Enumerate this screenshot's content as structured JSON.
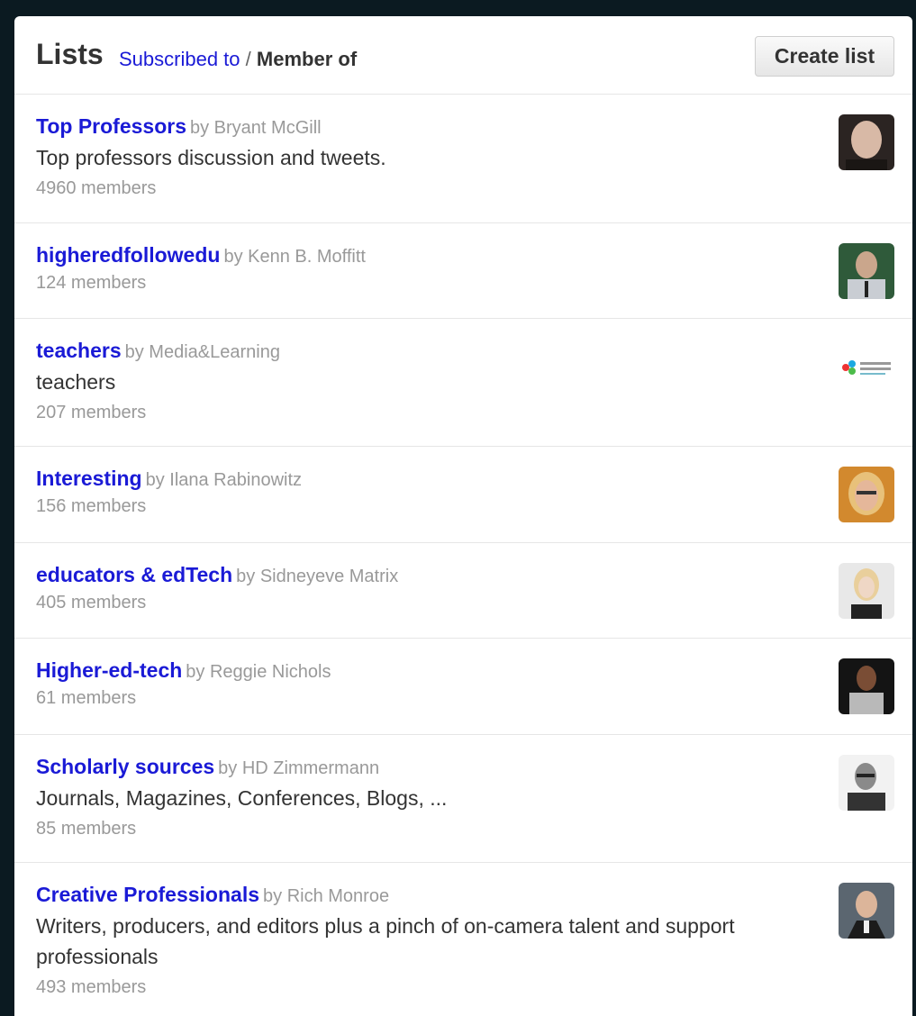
{
  "header": {
    "title": "Lists",
    "tab_subscribed": "Subscribed to",
    "separator": "/",
    "tab_member": "Member of",
    "create_label": "Create list"
  },
  "lists": [
    {
      "name": "Top Professors",
      "by": "by Bryant McGill",
      "description": "Top professors discussion and tweets.",
      "members": "4960 members"
    },
    {
      "name": "higheredfollowedu",
      "by": "by Kenn B. Moffitt",
      "description": "",
      "members": "124 members"
    },
    {
      "name": "teachers",
      "by": "by Media&Learning",
      "description": "teachers",
      "members": "207 members"
    },
    {
      "name": "Interesting",
      "by": "by Ilana Rabinowitz",
      "description": "",
      "members": "156 members"
    },
    {
      "name": "educators & edTech",
      "by": "by Sidneyeve Matrix",
      "description": "",
      "members": "405 members"
    },
    {
      "name": "Higher-ed-tech",
      "by": "by Reggie Nichols",
      "description": "",
      "members": "61 members"
    },
    {
      "name": "Scholarly sources",
      "by": "by HD Zimmermann",
      "description": "Journals, Magazines, Conferences, Blogs, ...",
      "members": "85 members"
    },
    {
      "name": "Creative Professionals",
      "by": "by Rich Monroe",
      "description": "Writers, producers, and editors plus a pinch of on-camera talent and support professionals",
      "members": "493 members"
    }
  ],
  "colors": {
    "link": "#1a1ad6",
    "muted": "#999999",
    "text": "#333333"
  }
}
